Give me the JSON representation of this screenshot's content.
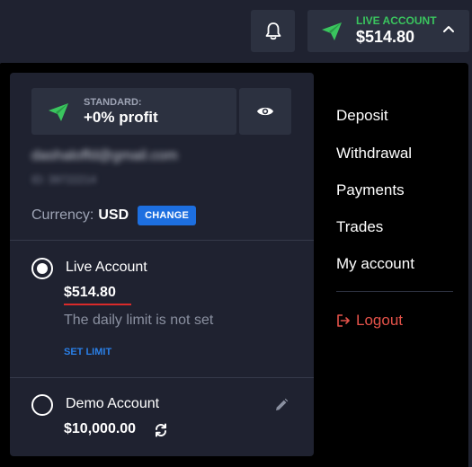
{
  "header": {
    "account_button": {
      "label": "LIVE ACCOUNT",
      "balance": "$514.80"
    }
  },
  "account_panel": {
    "plan": {
      "label": "STANDARD:",
      "value": "+0% profit"
    },
    "email": "dashaloffd@gmail.com",
    "user_id": "ID: 39722214",
    "currency": {
      "label": "Currency:",
      "value": "USD",
      "change_label": "CHANGE"
    },
    "accounts": [
      {
        "name": "Live Account",
        "balance": "$514.80",
        "note": "The daily limit is not set",
        "action_label": "SET LIMIT",
        "selected": true
      },
      {
        "name": "Demo Account",
        "balance": "$10,000.00",
        "selected": false
      }
    ]
  },
  "menu": {
    "items": [
      "Deposit",
      "Withdrawal",
      "Payments",
      "Trades",
      "My account"
    ],
    "logout_label": "Logout"
  },
  "colors": {
    "background": "#1f2230",
    "panel_button": "#2c3140",
    "dropdown": "#000000",
    "live_green": "#3ac55e",
    "accent_blue": "#1d6fe0",
    "logout_red": "#e6534a",
    "underline_red": "#d92a2a"
  },
  "icons": {
    "notifications": "bell-icon",
    "account_type": "paper-plane-icon",
    "toggle": "chevron-up-icon",
    "visibility": "eye-icon",
    "edit": "pencil-icon",
    "reset": "refresh-icon",
    "logout": "logout-icon"
  }
}
